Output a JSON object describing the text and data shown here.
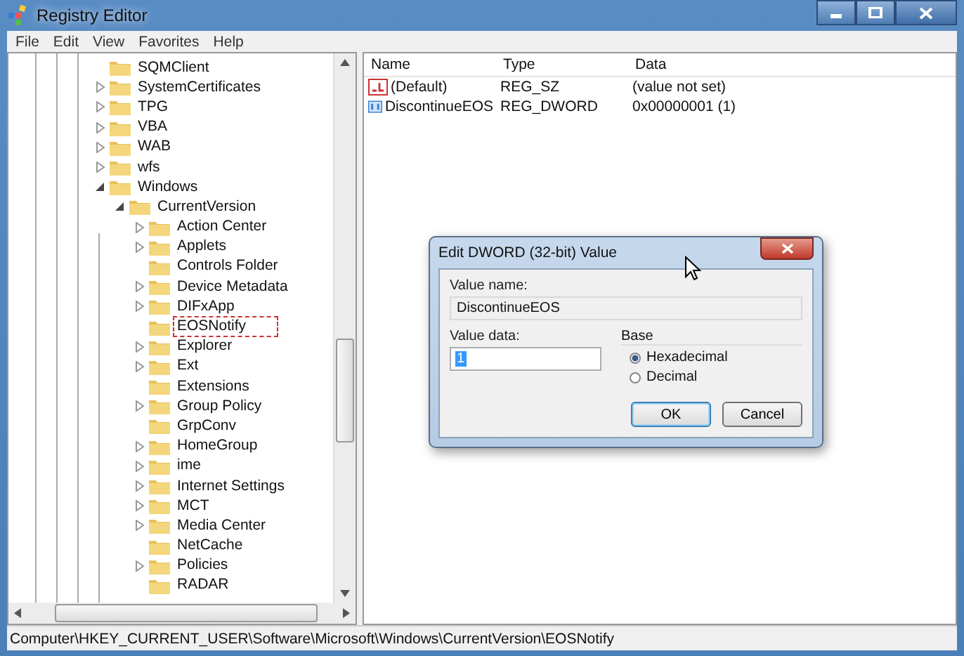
{
  "window": {
    "title": "Registry Editor"
  },
  "menu": [
    "File",
    "Edit",
    "View",
    "Favorites",
    "Help"
  ],
  "tree": [
    {
      "label": "SQMClient",
      "expandable": false,
      "expanded": false,
      "selected": false
    },
    {
      "label": "SystemCertificates",
      "expandable": true,
      "expanded": false,
      "selected": false
    },
    {
      "label": "TPG",
      "expandable": true,
      "expanded": false,
      "selected": false
    },
    {
      "label": "VBA",
      "expandable": true,
      "expanded": false,
      "selected": false
    },
    {
      "label": "WAB",
      "expandable": true,
      "expanded": false,
      "selected": false
    },
    {
      "label": "wfs",
      "expandable": true,
      "expanded": false,
      "selected": false
    },
    {
      "label": "Windows",
      "expandable": true,
      "expanded": true,
      "selected": false,
      "children": [
        {
          "label": "CurrentVersion",
          "expandable": true,
          "expanded": true,
          "selected": false,
          "children": [
            {
              "label": "Action Center",
              "expandable": true,
              "expanded": false,
              "selected": false
            },
            {
              "label": "Applets",
              "expandable": true,
              "expanded": false,
              "selected": false
            },
            {
              "label": "Controls Folder",
              "expandable": false,
              "expanded": false,
              "selected": false
            },
            {
              "label": "Device Metadata",
              "expandable": true,
              "expanded": false,
              "selected": false
            },
            {
              "label": "DIFxApp",
              "expandable": true,
              "expanded": false,
              "selected": false
            },
            {
              "label": "EOSNotify",
              "expandable": false,
              "expanded": false,
              "selected": true
            },
            {
              "label": "Explorer",
              "expandable": true,
              "expanded": false,
              "selected": false
            },
            {
              "label": "Ext",
              "expandable": true,
              "expanded": false,
              "selected": false
            },
            {
              "label": "Extensions",
              "expandable": false,
              "expanded": false,
              "selected": false
            },
            {
              "label": "Group Policy",
              "expandable": true,
              "expanded": false,
              "selected": false
            },
            {
              "label": "GrpConv",
              "expandable": false,
              "expanded": false,
              "selected": false
            },
            {
              "label": "HomeGroup",
              "expandable": true,
              "expanded": false,
              "selected": false
            },
            {
              "label": "ime",
              "expandable": true,
              "expanded": false,
              "selected": false
            },
            {
              "label": "Internet Settings",
              "expandable": true,
              "expanded": false,
              "selected": false
            },
            {
              "label": "MCT",
              "expandable": true,
              "expanded": false,
              "selected": false
            },
            {
              "label": "Media Center",
              "expandable": true,
              "expanded": false,
              "selected": false
            },
            {
              "label": "NetCache",
              "expandable": false,
              "expanded": false,
              "selected": false
            },
            {
              "label": "Policies",
              "expandable": true,
              "expanded": false,
              "selected": false
            },
            {
              "label": "RADAR",
              "expandable": false,
              "expanded": false,
              "selected": false
            }
          ]
        }
      ]
    }
  ],
  "values": {
    "columns": [
      "Name",
      "Type",
      "Data"
    ],
    "rows": [
      {
        "kind": "string",
        "name": "(Default)",
        "type": "REG_SZ",
        "data": "(value not set)"
      },
      {
        "kind": "binary",
        "name": "DiscontinueEOS",
        "type": "REG_DWORD",
        "data": "0x00000001 (1)"
      }
    ]
  },
  "dialog": {
    "title": "Edit DWORD (32-bit) Value",
    "value_name_label": "Value name:",
    "value_name": "DiscontinueEOS",
    "value_data_label": "Value data:",
    "value_data": "1",
    "base_label": "Base",
    "base_options": [
      {
        "label": "Hexadecimal",
        "selected": true
      },
      {
        "label": "Decimal",
        "selected": false
      }
    ],
    "buttons": [
      "OK",
      "Cancel"
    ]
  },
  "status_bar": "Computer\\HKEY_CURRENT_USER\\Software\\Microsoft\\Windows\\CurrentVersion\\EOSNotify"
}
